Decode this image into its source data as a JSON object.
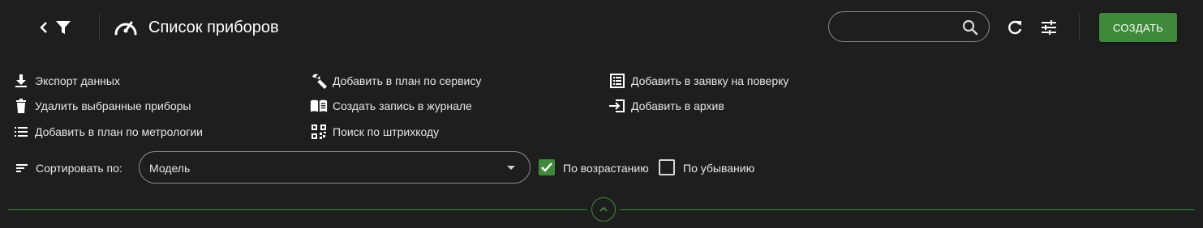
{
  "header": {
    "title": "Список приборов",
    "search": {
      "value": "",
      "placeholder": ""
    },
    "create_label": "СОЗДАТЬ",
    "icons": [
      "chevron-left-icon",
      "filter-icon",
      "speedometer-icon",
      "search-icon",
      "refresh-icon",
      "tune-icon"
    ]
  },
  "actions": {
    "col1": [
      {
        "label": "Экспорт данных",
        "icon": "download-icon"
      },
      {
        "label": "Удалить выбранные приборы",
        "icon": "trash-icon"
      },
      {
        "label": "Добавить в план по метрологии",
        "icon": "list-icon"
      }
    ],
    "col2": [
      {
        "label": "Добавить в план по сервису",
        "icon": "wrench-icon"
      },
      {
        "label": "Создать запись в журнале",
        "icon": "book-icon"
      },
      {
        "label": "Поиск по штрихкоду",
        "icon": "qr-code-icon"
      }
    ],
    "col3": [
      {
        "label": "Добавить в заявку на поверку",
        "icon": "list-box-icon"
      },
      {
        "label": "Добавить в архив",
        "icon": "archive-in-icon"
      }
    ]
  },
  "sort": {
    "label": "Сортировать по:",
    "selected": "Модель",
    "ascending": {
      "label": "По возрастанию",
      "checked": true
    },
    "descending": {
      "label": "По убыванию",
      "checked": false
    }
  },
  "colors": {
    "background": "#1e1e1e",
    "accent": "#3f8a3a",
    "text": "#e6e6e6",
    "border": "#8a8a8a"
  }
}
